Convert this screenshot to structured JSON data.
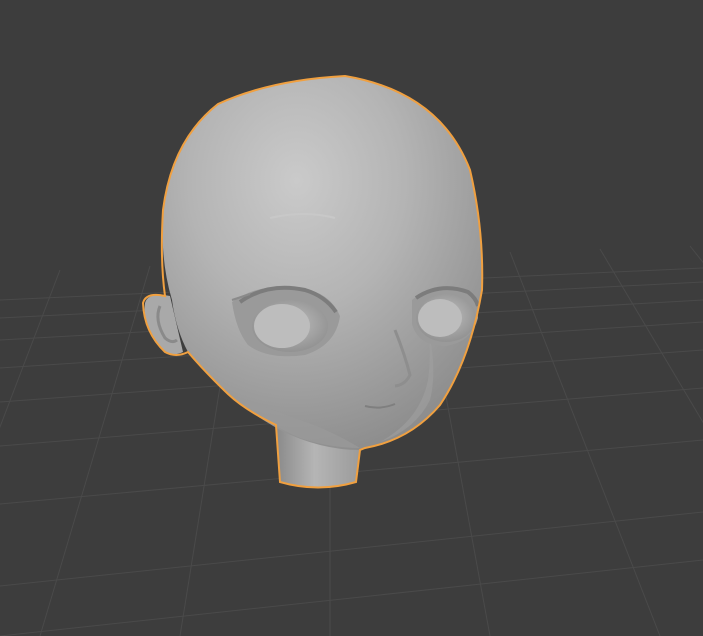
{
  "viewport": {
    "background_color": "#3d3d3d",
    "grid_line_color": "#4a4a4a",
    "grid_visible": true,
    "selection_outline_color": "#f0a040",
    "mesh_color": "#b8b8b8"
  },
  "scene_object": {
    "type": "mesh",
    "shape": "stylized anime head with neck",
    "selected": true
  }
}
